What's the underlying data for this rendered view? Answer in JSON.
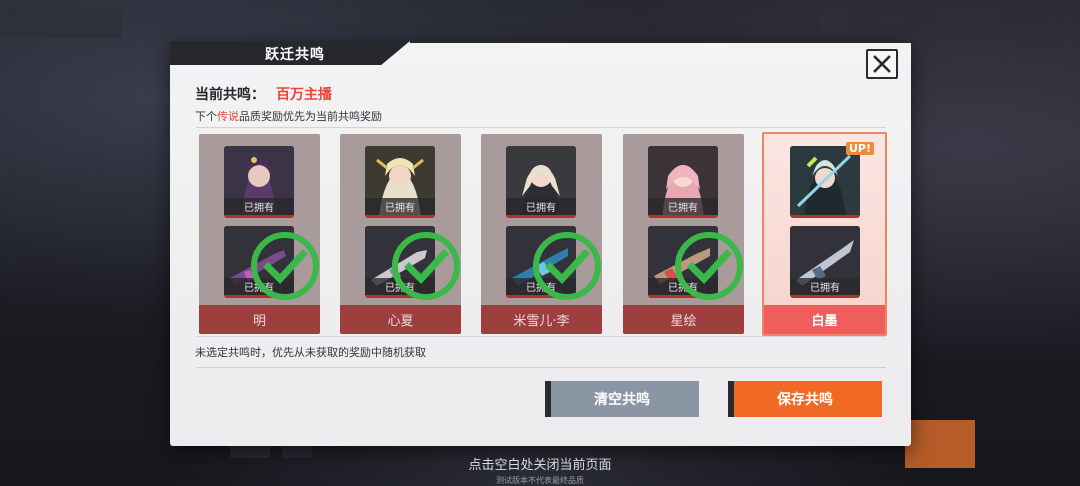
{
  "dialog": {
    "title": "跃迁共鸣",
    "current_label": "当前共鸣：",
    "current_value": "百万主播",
    "sub_prefix": "下个",
    "sub_highlight": "传说",
    "sub_suffix": "品质奖励优先为当前共鸣奖励",
    "hint": "未选定共鸣时，优先从未获取的奖励中随机获取",
    "clear_label": "清空共鸣",
    "save_label": "保存共鸣",
    "close_icon": "close-icon"
  },
  "cards": [
    {
      "name": "明",
      "top_tag": "已拥有",
      "bottom_tag": "已拥有",
      "selected": false,
      "checked": true
    },
    {
      "name": "心夏",
      "top_tag": "已拥有",
      "bottom_tag": "已拥有",
      "selected": false,
      "checked": true
    },
    {
      "name": "米雪儿·李",
      "top_tag": "已拥有",
      "bottom_tag": "已拥有",
      "selected": false,
      "checked": true
    },
    {
      "name": "星绘",
      "top_tag": "已拥有",
      "bottom_tag": "已拥有",
      "selected": false,
      "checked": true
    },
    {
      "name": "白墨",
      "top_tag": "",
      "bottom_tag": "已拥有",
      "selected": true,
      "checked": false,
      "badge": "UP!"
    }
  ],
  "footer": {
    "close_hint": "点击空白处关闭当前页面",
    "test_notice": "测试版本不代表最终品质"
  },
  "colors": {
    "accent_red": "#e5453a",
    "save_orange": "#f06a25",
    "clear_gray": "#8a96a4",
    "check_green": "#3bb84a"
  }
}
